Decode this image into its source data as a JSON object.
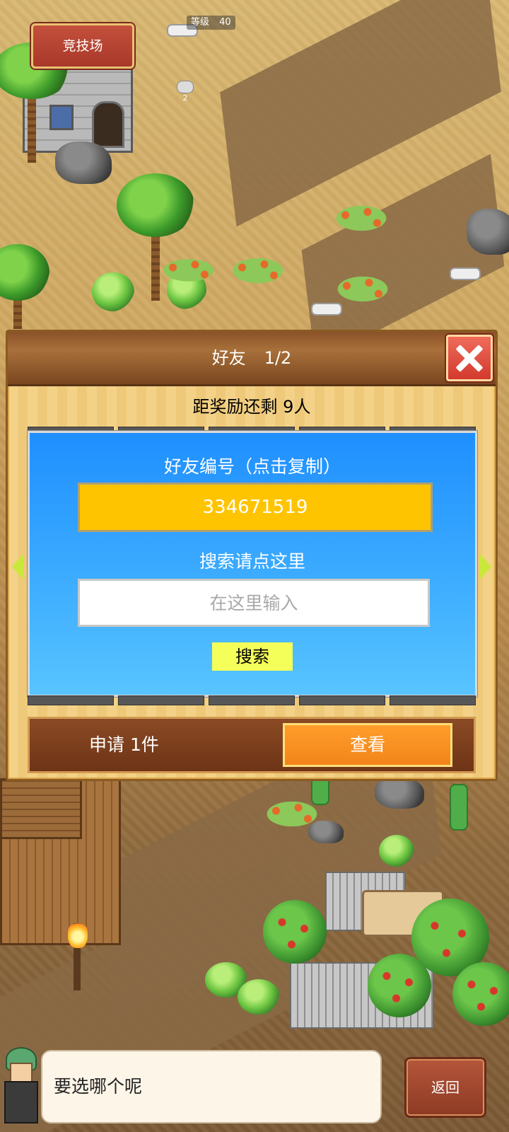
{
  "hud": {
    "level_label": "等级",
    "level_value": "40",
    "arena_label": "竞技场",
    "cloud_count": "2"
  },
  "friend_dialog": {
    "title": "好友",
    "page": "1/2",
    "reward_text": "距奖励还剩 9人",
    "id_label": "好友编号（点击复制）",
    "friend_id": "334671519",
    "search_label": "搜索请点这里",
    "search_placeholder": "在这里输入",
    "search_button": "搜索",
    "apply_text": "申请 1件",
    "view_button": "查看"
  },
  "bottom": {
    "speech_text": "要选哪个呢",
    "back_button": "返回"
  },
  "colors": {
    "panel_blue": "#1f8fff",
    "id_box_yellow": "#ffc400",
    "search_button_yellow": "#f4ff5a",
    "view_button_orange": "#f2841a",
    "close_red": "#d23a2d"
  }
}
